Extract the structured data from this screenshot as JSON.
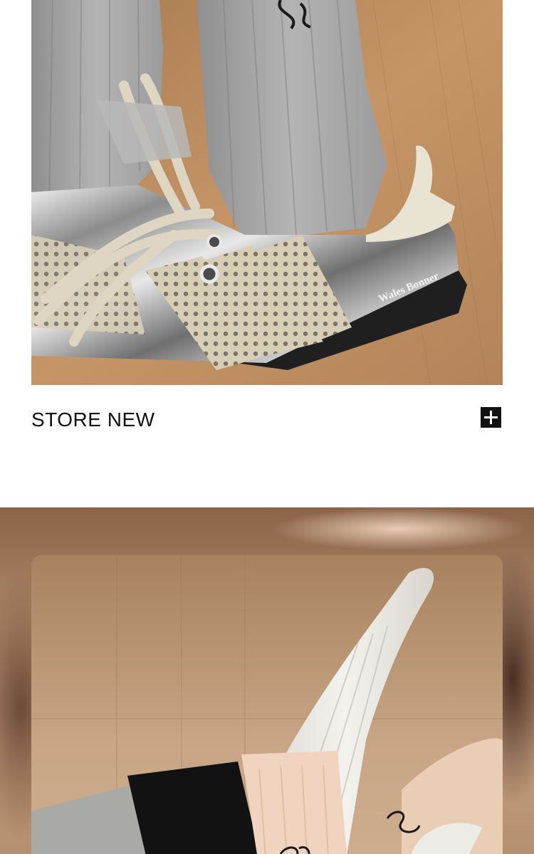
{
  "product": {
    "title": "STORE NEW",
    "brand_label": "Wales Bonner"
  },
  "icons": {
    "expand": "plus-icon"
  },
  "colors": {
    "text": "#111111",
    "button_bg": "#111111",
    "page_bg": "#ffffff"
  }
}
